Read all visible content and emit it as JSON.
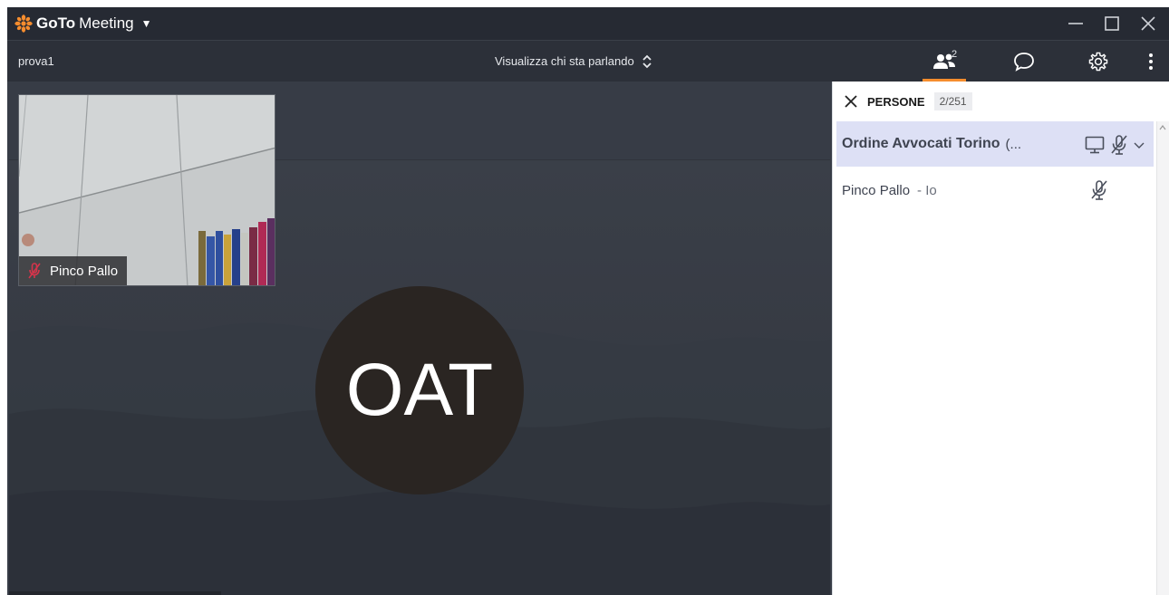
{
  "app": {
    "brand_bold": "GoTo",
    "brand_light": "Meeting"
  },
  "toolbar": {
    "meeting_name": "prova1",
    "view_mode": "Visualizza chi sta parlando",
    "people_count": "2"
  },
  "stage": {
    "speaker_initials": "OAT",
    "self_name": "Pinco Pallo"
  },
  "panel": {
    "title": "PERSONE",
    "count": "2/251",
    "group": {
      "name": "Ordine Avvocati Torino",
      "suffix": "(..."
    },
    "members": [
      {
        "name": "Pinco Pallo",
        "suffix": "- Io"
      }
    ]
  },
  "colors": {
    "accent": "#f68d2e",
    "titlebar": "#262a33",
    "toolbar": "#2c3039",
    "stage": "#373c46",
    "group_highlight": "#dde0f5",
    "muted_red": "#d6344b"
  }
}
